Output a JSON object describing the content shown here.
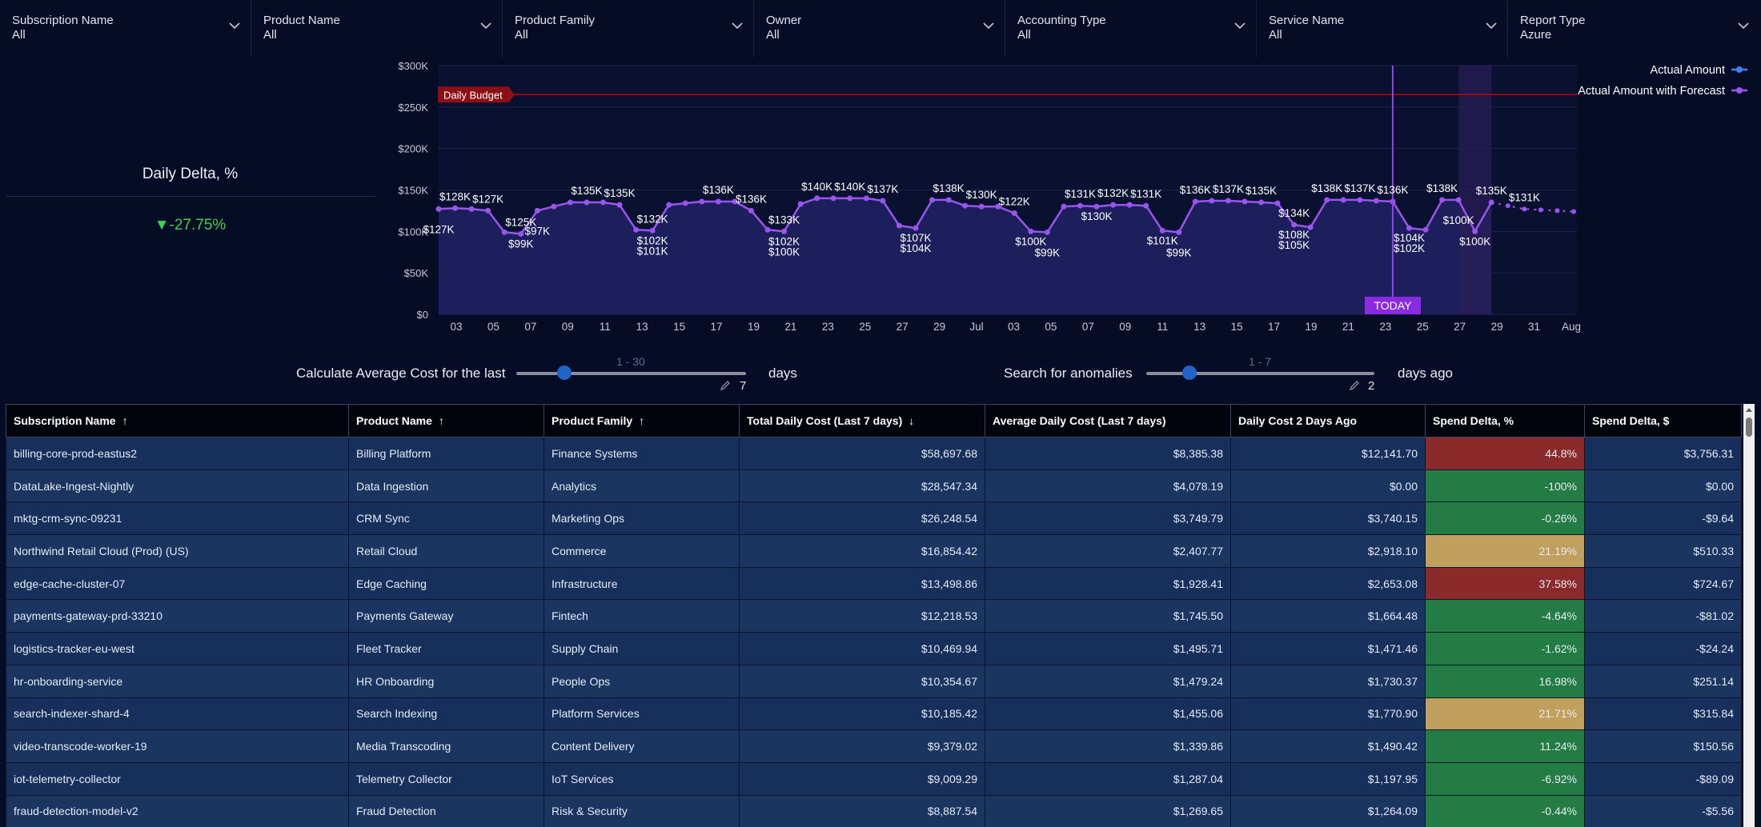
{
  "filters": [
    {
      "label": "Subscription Name",
      "value": "All"
    },
    {
      "label": "Product Name",
      "value": "All"
    },
    {
      "label": "Product Family",
      "value": "All"
    },
    {
      "label": "Owner",
      "value": "All"
    },
    {
      "label": "Accounting Type",
      "value": "All"
    },
    {
      "label": "Service Name",
      "value": "All"
    },
    {
      "label": "Report Type",
      "value": "Azure"
    }
  ],
  "kpi": {
    "title": "Daily Delta, %",
    "value": "▼-27.75%",
    "color": "#39d353"
  },
  "chart_data": {
    "type": "area",
    "y_ticks": [
      "$300K",
      "$250K",
      "$200K",
      "$150K",
      "$100K",
      "$50K",
      "$0"
    ],
    "y_tick_values": [
      300,
      250,
      200,
      150,
      100,
      50,
      0
    ],
    "ylim": [
      0,
      300
    ],
    "x_ticks": [
      "03",
      "05",
      "07",
      "09",
      "11",
      "13",
      "15",
      "17",
      "19",
      "21",
      "23",
      "25",
      "27",
      "29",
      "Jul",
      "03",
      "05",
      "07",
      "09",
      "11",
      "13",
      "15",
      "17",
      "19",
      "21",
      "23",
      "25",
      "27",
      "29",
      "31",
      "Aug"
    ],
    "budget": {
      "label": "Daily Budget",
      "value": 265,
      "color": "#c00000"
    },
    "today_label": "TODAY",
    "today_index": 58,
    "series": [
      {
        "name": "Actual Amount",
        "color": "#3b82f6",
        "values": [
          127,
          128,
          127,
          125,
          99,
          97,
          125,
          130,
          135,
          135,
          135,
          132,
          102,
          101,
          132,
          134,
          136,
          136,
          136,
          125,
          102,
          100,
          133,
          140,
          140,
          140,
          140,
          137,
          107,
          104,
          138,
          138,
          131,
          130,
          130,
          122,
          100,
          99,
          130,
          131,
          130,
          132,
          132,
          131,
          101,
          99,
          136,
          137,
          137,
          136,
          135,
          134,
          108,
          105,
          138,
          138,
          138,
          137,
          136,
          104,
          102,
          138,
          138,
          100,
          135
        ]
      },
      {
        "name": "Actual Amount with Forecast",
        "color": "#9955ee",
        "values": [
          131,
          127,
          126,
          125,
          124
        ]
      }
    ],
    "point_labels": [
      {
        "i": 1,
        "text": "$128K",
        "pos": "above"
      },
      {
        "i": 0,
        "text": "$127K",
        "pos": "below"
      },
      {
        "i": 3,
        "text": "$127K",
        "pos": "above"
      },
      {
        "i": 5,
        "text": "$125K",
        "pos": "above"
      },
      {
        "i": 5,
        "text": "$99K",
        "pos": "below2"
      },
      {
        "i": 6,
        "text": "$97K",
        "pos": "below"
      },
      {
        "i": 9,
        "text": "$135K",
        "pos": "above"
      },
      {
        "i": 11,
        "text": "$135K",
        "pos": "above"
      },
      {
        "i": 13,
        "text": "$132K",
        "pos": "above"
      },
      {
        "i": 13,
        "text": "$102K",
        "pos": "below2"
      },
      {
        "i": 13,
        "text": "$101K",
        "pos": "below"
      },
      {
        "i": 17,
        "text": "$136K",
        "pos": "above"
      },
      {
        "i": 19,
        "text": "$136K",
        "pos": "above"
      },
      {
        "i": 21,
        "text": "$133K",
        "pos": "above"
      },
      {
        "i": 21,
        "text": "$102K",
        "pos": "below2"
      },
      {
        "i": 21,
        "text": "$100K",
        "pos": "below"
      },
      {
        "i": 23,
        "text": "$140K",
        "pos": "above"
      },
      {
        "i": 25,
        "text": "$140K",
        "pos": "above"
      },
      {
        "i": 27,
        "text": "$137K",
        "pos": "above"
      },
      {
        "i": 29,
        "text": "$107K",
        "pos": "below2"
      },
      {
        "i": 29,
        "text": "$104K",
        "pos": "below"
      },
      {
        "i": 31,
        "text": "$138K",
        "pos": "above"
      },
      {
        "i": 33,
        "text": "$130K",
        "pos": "above"
      },
      {
        "i": 35,
        "text": "$122K",
        "pos": "above"
      },
      {
        "i": 36,
        "text": "$100K",
        "pos": "below2"
      },
      {
        "i": 37,
        "text": "$99K",
        "pos": "below"
      },
      {
        "i": 39,
        "text": "$131K",
        "pos": "above"
      },
      {
        "i": 41,
        "text": "$132K",
        "pos": "above"
      },
      {
        "i": 40,
        "text": "$130K",
        "pos": "below2"
      },
      {
        "i": 43,
        "text": "$131K",
        "pos": "above"
      },
      {
        "i": 44,
        "text": "$101K",
        "pos": "below2"
      },
      {
        "i": 45,
        "text": "$99K",
        "pos": "below"
      },
      {
        "i": 46,
        "text": "$136K",
        "pos": "above"
      },
      {
        "i": 48,
        "text": "$137K",
        "pos": "above"
      },
      {
        "i": 50,
        "text": "$135K",
        "pos": "above"
      },
      {
        "i": 52,
        "text": "$134K",
        "pos": "above"
      },
      {
        "i": 52,
        "text": "$108K",
        "pos": "below2"
      },
      {
        "i": 52,
        "text": "$105K",
        "pos": "below"
      },
      {
        "i": 54,
        "text": "$138K",
        "pos": "above"
      },
      {
        "i": 56,
        "text": "$137K",
        "pos": "above"
      },
      {
        "i": 58,
        "text": "$136K",
        "pos": "above"
      },
      {
        "i": 59,
        "text": "$104K",
        "pos": "below2"
      },
      {
        "i": 59,
        "text": "$102K",
        "pos": "below"
      },
      {
        "i": 61,
        "text": "$138K",
        "pos": "above"
      },
      {
        "i": 63,
        "text": "$100K",
        "pos": "below2"
      },
      {
        "i": 62,
        "text": "$100K",
        "pos": "below"
      },
      {
        "i": 64,
        "text": "$135K",
        "pos": "above"
      },
      {
        "i": 66,
        "text": "$131K",
        "pos": "above"
      }
    ],
    "grid": true,
    "legend": "top-right"
  },
  "sliders": [
    {
      "label": "Calculate Average Cost for the last",
      "range": "1 - 30",
      "value": "7",
      "unit": "days",
      "fraction": 0.21
    },
    {
      "label": "Search for anomalies",
      "range": "1 - 7",
      "value": "2",
      "unit": "days ago",
      "fraction": 0.19
    }
  ],
  "table": {
    "columns": [
      {
        "label": "Subscription Name",
        "sort": "↑"
      },
      {
        "label": "Product Name",
        "sort": "↑"
      },
      {
        "label": "Product Family",
        "sort": "↑"
      },
      {
        "label": "Total Daily Cost (Last 7 days)",
        "sort": "↓"
      },
      {
        "label": "Average Daily Cost (Last 7 days)",
        "sort": ""
      },
      {
        "label": "Daily Cost 2 Days Ago",
        "sort": ""
      },
      {
        "label": "Spend Delta, %",
        "sort": ""
      },
      {
        "label": "Spend Delta, $",
        "sort": ""
      }
    ],
    "rows": [
      {
        "cells": [
          "billing-core-prod-eastus2",
          "Billing Platform",
          "Finance Systems",
          "$58,697.68",
          "$8,385.38",
          "$12,141.70",
          "44.8%",
          "$3,756.31"
        ],
        "status": "red"
      },
      {
        "cells": [
          "DataLake-Ingest-Nightly",
          "Data Ingestion",
          "Analytics",
          "$28,547.34",
          "$4,078.19",
          "$0.00",
          "-100%",
          "$0.00"
        ],
        "status": "green"
      },
      {
        "cells": [
          "mktg-crm-sync-09231",
          "CRM Sync",
          "Marketing Ops",
          "$26,248.54",
          "$3,749.79",
          "$3,740.15",
          "-0.26%",
          "-$9.64"
        ],
        "status": "green"
      },
      {
        "cells": [
          "Northwind Retail Cloud (Prod) (US)",
          "Retail Cloud",
          "Commerce",
          "$16,854.42",
          "$2,407.77",
          "$2,918.10",
          "21.19%",
          "$510.33"
        ],
        "status": "yellow"
      },
      {
        "cells": [
          "edge-cache-cluster-07",
          "Edge Caching",
          "Infrastructure",
          "$13,498.86",
          "$1,928.41",
          "$2,653.08",
          "37.58%",
          "$724.67"
        ],
        "status": "red"
      },
      {
        "cells": [
          "payments-gateway-prd-33210",
          "Payments Gateway",
          "Fintech",
          "$12,218.53",
          "$1,745.50",
          "$1,664.48",
          "-4.64%",
          "-$81.02"
        ],
        "status": "green"
      },
      {
        "cells": [
          "logistics-tracker-eu-west",
          "Fleet Tracker",
          "Supply Chain",
          "$10,469.94",
          "$1,495.71",
          "$1,471.46",
          "-1.62%",
          "-$24.24"
        ],
        "status": "green"
      },
      {
        "cells": [
          "hr-onboarding-service",
          "HR Onboarding",
          "People Ops",
          "$10,354.67",
          "$1,479.24",
          "$1,730.37",
          "16.98%",
          "$251.14"
        ],
        "status": "green"
      },
      {
        "cells": [
          "search-indexer-shard-4",
          "Search Indexing",
          "Platform Services",
          "$10,185.42",
          "$1,455.06",
          "$1,770.90",
          "21.71%",
          "$315.84"
        ],
        "status": "yellow"
      },
      {
        "cells": [
          "video-transcode-worker-19",
          "Media Transcoding",
          "Content Delivery",
          "$9,379.02",
          "$1,339.86",
          "$1,490.42",
          "11.24%",
          "$150.56"
        ],
        "status": "green"
      },
      {
        "cells": [
          "iot-telemetry-collector",
          "Telemetry Collector",
          "IoT Services",
          "$9,009.29",
          "$1,287.04",
          "$1,197.95",
          "-6.92%",
          "-$89.09"
        ],
        "status": "green"
      },
      {
        "cells": [
          "fraud-detection-model-v2",
          "Fraud Detection",
          "Risk & Security",
          "$8,887.54",
          "$1,269.65",
          "$1,264.09",
          "-0.44%",
          "-$5.56"
        ],
        "status": "green"
      }
    ]
  }
}
